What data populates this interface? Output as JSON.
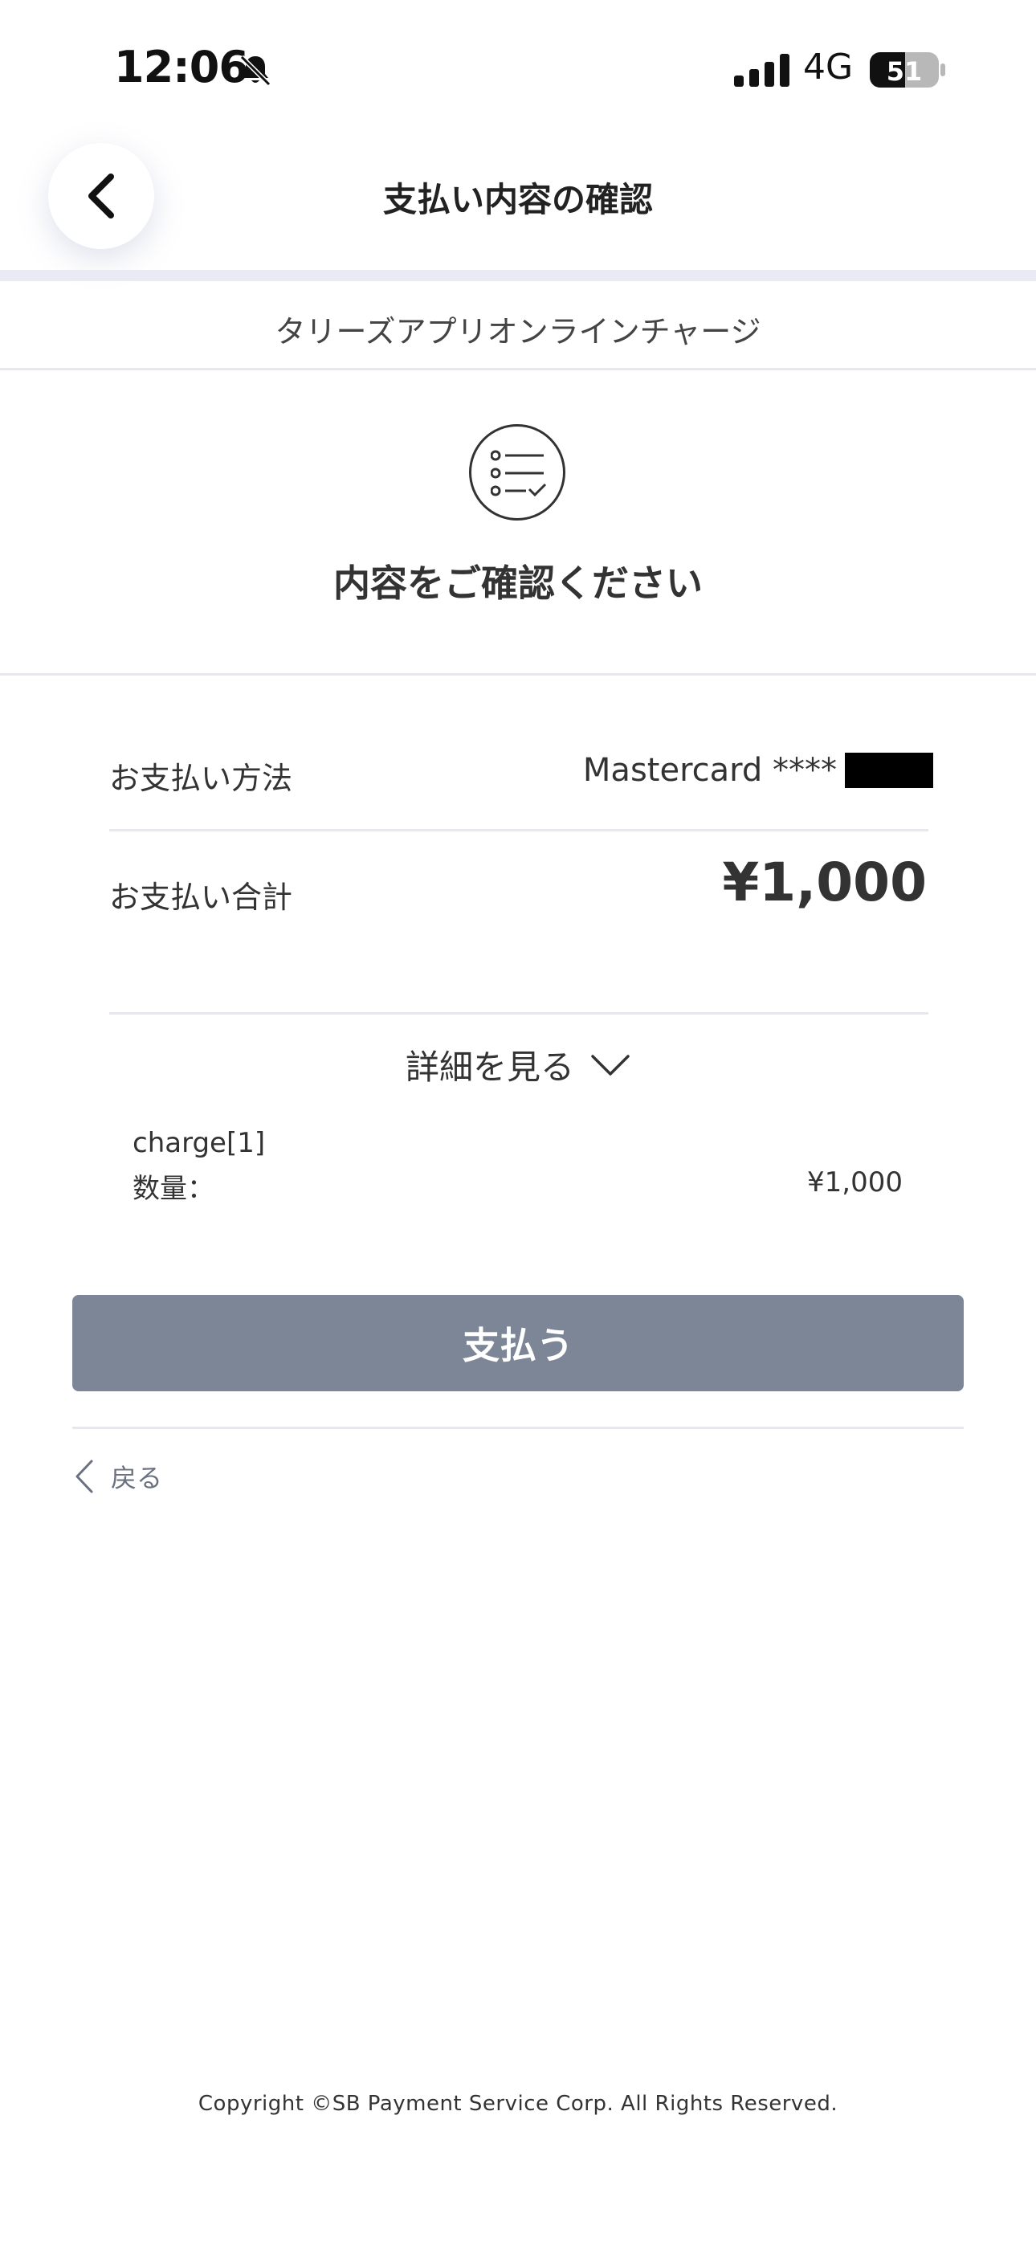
{
  "status_bar": {
    "time": "12:06",
    "network": "4G",
    "battery": "51",
    "icons": [
      "bell-muted-icon",
      "signal-icon",
      "battery-icon"
    ]
  },
  "header": {
    "title": "支払い内容の確認",
    "back_icon": "chevron-left-icon"
  },
  "merchant": {
    "name": "タリーズアプリオンラインチャージ"
  },
  "confirm": {
    "icon": "checklist-icon",
    "heading": "内容をご確認ください"
  },
  "summary": {
    "payment_method_label": "お支払い方法",
    "payment_method_value": "Mastercard ****",
    "total_label": "お支払い合計",
    "total_value": "¥1,000"
  },
  "details": {
    "toggle_label": "詳細を見る",
    "toggle_icon": "chevron-down-icon",
    "item_name": "charge[1]",
    "quantity_label": "数量：",
    "item_price": "¥1,000"
  },
  "actions": {
    "pay_label": "支払う",
    "back_label": "戻る"
  },
  "footer": {
    "copyright": "Copyright ©SB Payment Service Corp. All Rights Reserved."
  },
  "colors": {
    "pay_button": "#7c8696",
    "header_band": "#e8ebf3",
    "divider": "#e6e8ee"
  }
}
